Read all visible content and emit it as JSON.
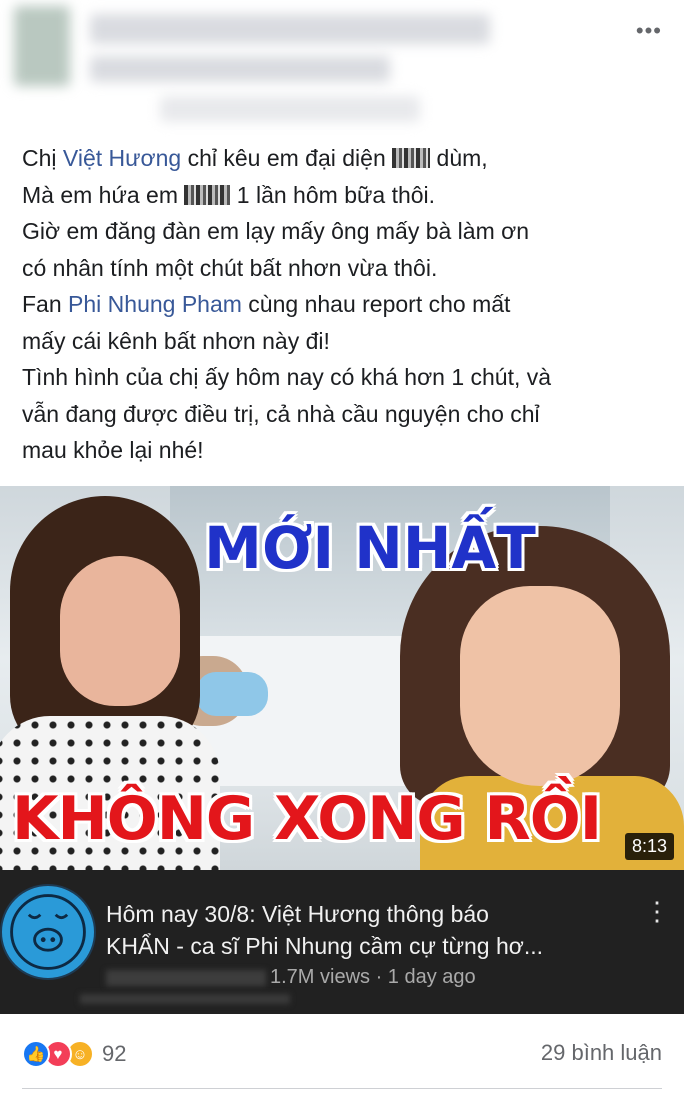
{
  "post": {
    "more_icon": "more-horizontal-icon",
    "text": {
      "line1_pre": "Chị ",
      "line1_mention": "Việt Hương",
      "line1_mid": " chỉ kêu em đại diện ",
      "line1_post": " dùm,",
      "line2_pre": "Mà em hứa em ",
      "line2_post": " 1 lần hôm bữa thôi.",
      "line3": "Giờ em đăng đàn em lạy mấy ông mấy bà làm ơn",
      "line4": "có nhân tính một chút bất nhơn vừa thôi.",
      "line5_pre": "Fan ",
      "line5_mention": "Phi Nhung Pham",
      "line5_post": " cùng nhau report cho mất",
      "line6": "mấy cái kênh bất nhơn này đi!",
      "line7": "Tình hình của chị ấy hôm nay có khá hơn 1 chút, và",
      "line8": "vẫn đang được điều trị, cả nhà cầu nguyện cho chỉ",
      "line9": "mau khỏe lại nhé!"
    }
  },
  "video": {
    "thumbnail_top_text": "MỚI NHẤT",
    "thumbnail_bottom_text": "KHÔNG XONG RỒI",
    "duration": "8:13",
    "title_line1": "Hôm nay 30/8: Việt Hương thông báo",
    "title_line2": "KHẨN - ca sĩ Phi Nhung cầm cự từng hơ...",
    "meta": "1.7M views · 1 day ago",
    "more_icon": "more-vertical-icon",
    "avatar_icon": "pig-face-icon"
  },
  "footer": {
    "reaction_count": "92",
    "comments": "29 bình luận",
    "reactions": [
      "like-icon",
      "love-icon",
      "care-icon"
    ]
  },
  "colors": {
    "mention": "#385898",
    "video_bar": "#212121",
    "title_blue": "#2032c9",
    "title_red": "#e3161b"
  }
}
